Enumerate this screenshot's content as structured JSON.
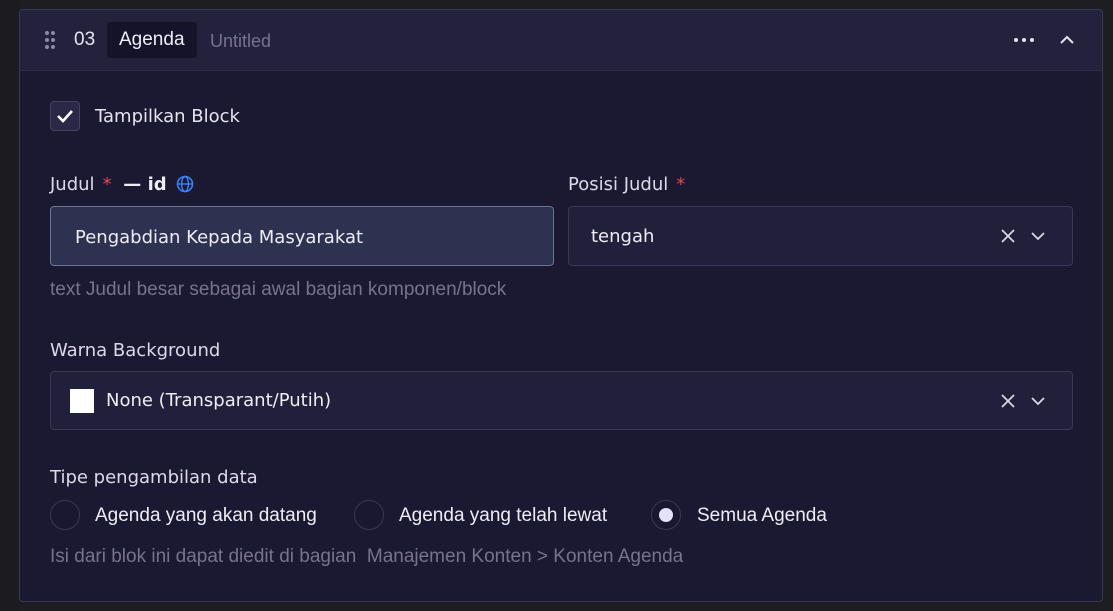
{
  "block": {
    "number": "03",
    "type": "Agenda",
    "name": "Untitled"
  },
  "show_block": {
    "label": "Tampilkan Block",
    "checked": true
  },
  "title_field": {
    "label": "Judul",
    "required_mark": "*",
    "lang_tag": "— id",
    "value": "Pengabdian Kepada Masyarakat",
    "helper": "text Judul besar sebagai awal bagian komponen/block"
  },
  "title_position": {
    "label": "Posisi Judul",
    "required_mark": "*",
    "value": "tengah"
  },
  "background": {
    "label": "Warna Background",
    "value": "None (Transparant/Putih)",
    "swatch_color": "#ffffff"
  },
  "data_type": {
    "label": "Tipe pengambilan data",
    "options": [
      {
        "label": "Agenda yang akan datang",
        "checked": false
      },
      {
        "label": "Agenda yang telah lewat",
        "checked": false
      },
      {
        "label": "Semua Agenda",
        "checked": true
      }
    ],
    "helper": "Isi dari blok ini dapat diedit di bagian  Manajemen Konten > Konten Agenda"
  },
  "icons": {
    "drag": "drag-handle-icon",
    "more": "more-horizontal-icon",
    "collapse": "chevron-up-icon",
    "check": "check-icon",
    "globe": "globe-icon",
    "clear": "close-icon",
    "dropdown": "chevron-down-icon"
  },
  "colors": {
    "panel_bg": "#1b1832",
    "header_bg": "#24213d",
    "required": "#e5484d",
    "globe": "#3b82f6",
    "radio_selected": "#e4e1ff"
  }
}
